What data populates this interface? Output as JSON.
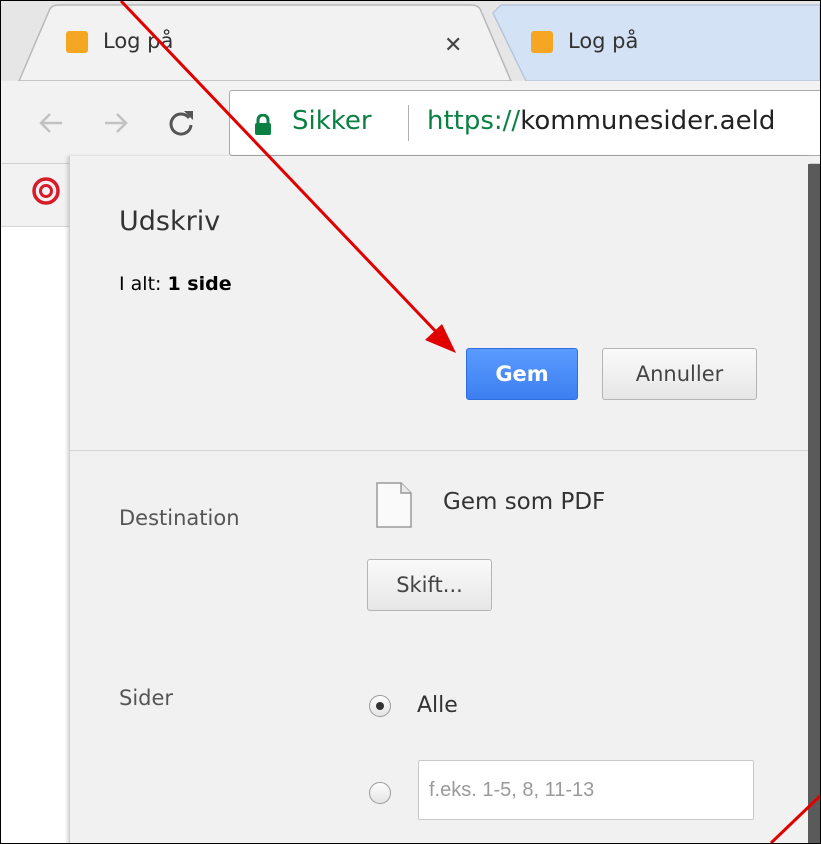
{
  "tabs": [
    {
      "title": "Log på",
      "active": true
    },
    {
      "title": "Log på",
      "active": false
    }
  ],
  "omnibox": {
    "security_label": "Sikker",
    "url_scheme": "https://",
    "url_host": "kommunesider.aeld"
  },
  "print": {
    "title": "Udskriv",
    "summary_prefix": "I alt:",
    "summary_value": "1 side",
    "save_button": "Gem",
    "cancel_button": "Annuller",
    "destination_label": "Destination",
    "destination_value": "Gem som PDF",
    "change_button": "Skift...",
    "pages_label": "Sider",
    "pages_all_option": "Alle",
    "pages_custom_placeholder": "f.eks. 1-5, 8, 11-13"
  },
  "colors": {
    "accent_button": "#4d90fe",
    "secure_green": "#0b8043",
    "annotation_arrow": "#e00000"
  },
  "icons": {
    "tab_favicon": "site-favicon-icon",
    "close": "close-icon",
    "back": "back-arrow-icon",
    "forward": "forward-arrow-icon",
    "reload": "reload-icon",
    "lock": "lock-icon",
    "bookmark": "bookmark-swirl-icon",
    "destination": "document-icon"
  }
}
